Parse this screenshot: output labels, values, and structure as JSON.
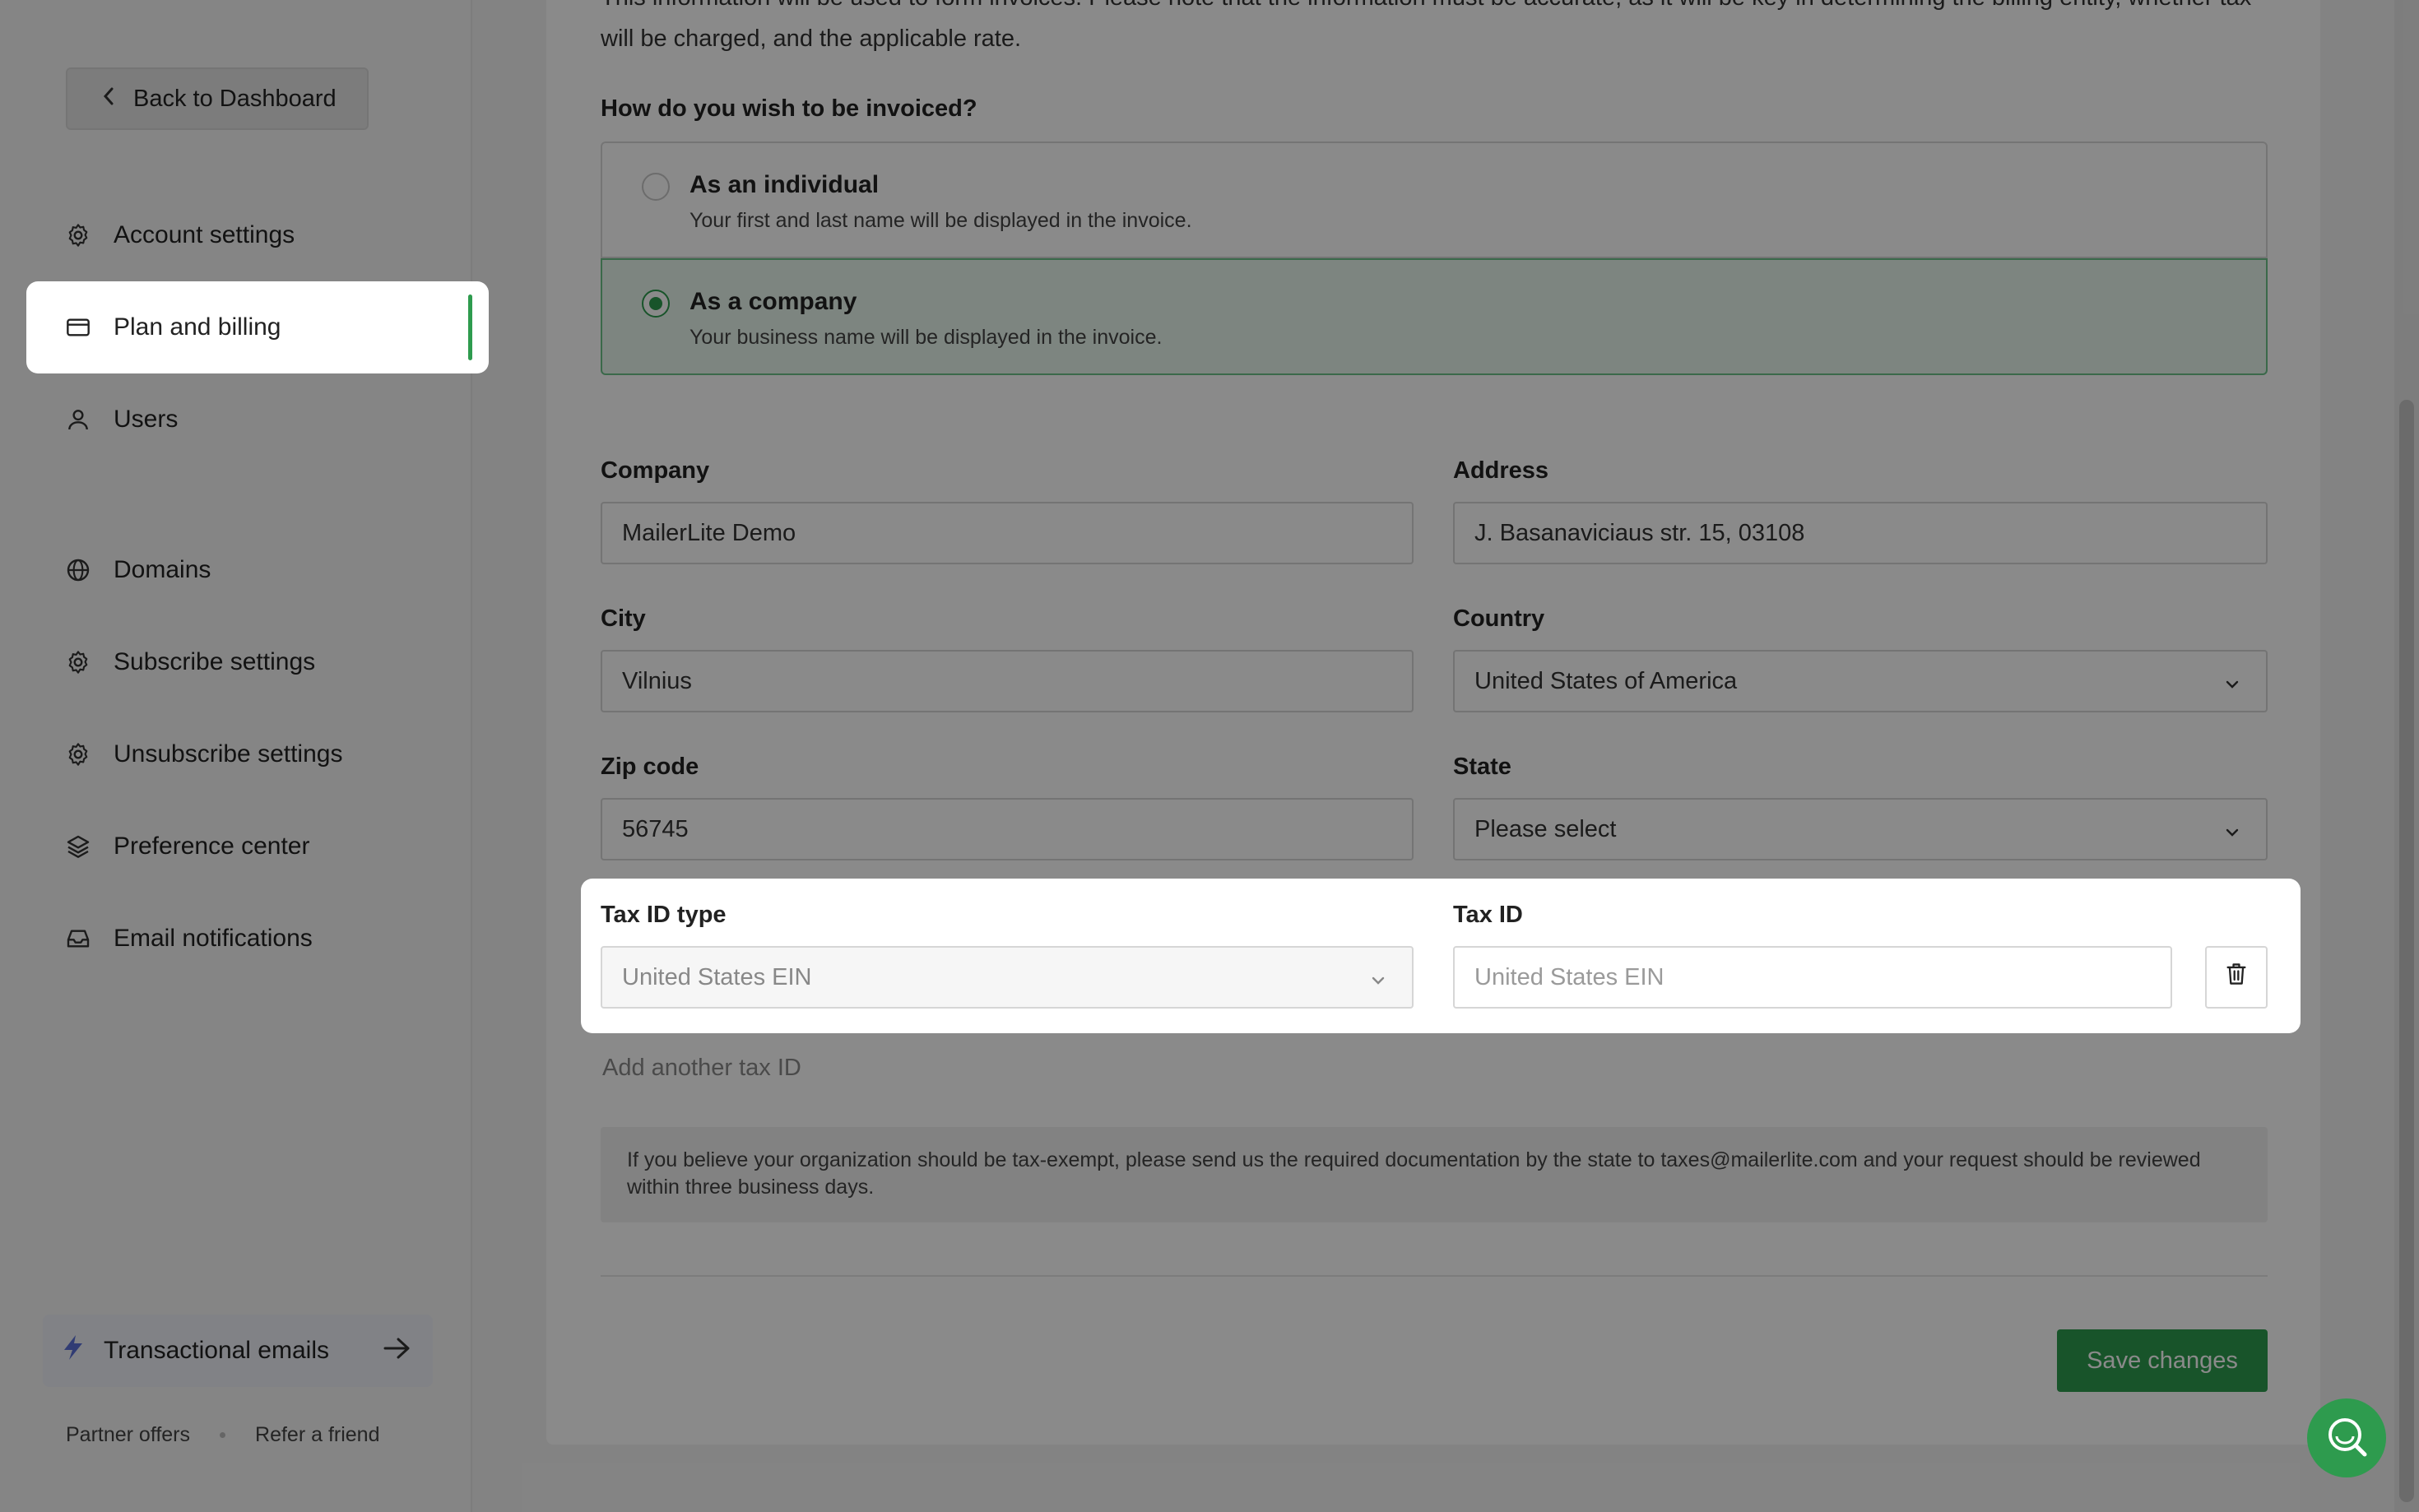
{
  "sidebar": {
    "back_label": "Back to Dashboard",
    "items": [
      {
        "label": "Account settings",
        "icon": "gear-icon"
      },
      {
        "label": "Plan and billing",
        "icon": "credit-card-icon",
        "active": true
      },
      {
        "label": "Users",
        "icon": "user-icon"
      },
      {
        "label": "Domains",
        "icon": "globe-icon"
      },
      {
        "label": "Subscribe settings",
        "icon": "gear-icon"
      },
      {
        "label": "Unsubscribe settings",
        "icon": "gear-icon"
      },
      {
        "label": "Preference center",
        "icon": "layers-icon"
      },
      {
        "label": "Email notifications",
        "icon": "inbox-icon"
      }
    ],
    "transactional_label": "Transactional emails",
    "footer": {
      "partner": "Partner offers",
      "refer": "Refer a friend"
    }
  },
  "main": {
    "intro": "This information will be used to form invoices. Please note that the information must be accurate, as it will be key in determining the billing entity, whether tax will be charged, and the applicable rate.",
    "invoice_question": "How do you wish to be invoiced?",
    "options": [
      {
        "title": "As an individual",
        "subtitle": "Your first and last name will be displayed in the invoice.",
        "selected": false
      },
      {
        "title": "As a company",
        "subtitle": "Your business name will be displayed in the invoice.",
        "selected": true
      }
    ],
    "fields": {
      "company": {
        "label": "Company",
        "value": "MailerLite Demo"
      },
      "address": {
        "label": "Address",
        "value": "J. Basanaviciaus str. 15, 03108"
      },
      "city": {
        "label": "City",
        "value": "Vilnius"
      },
      "country": {
        "label": "Country",
        "value": "United States of America"
      },
      "zip": {
        "label": "Zip code",
        "value": "56745"
      },
      "state": {
        "label": "State",
        "value": "Please select"
      },
      "tax_id_type": {
        "label": "Tax ID type",
        "value": "United States EIN"
      },
      "tax_id": {
        "label": "Tax ID",
        "placeholder": "United States EIN"
      }
    },
    "add_tax": "Add another tax ID",
    "notice": "If you believe your organization should be tax-exempt, please send us the required documentation by the state to taxes@mailerlite.com and your request should be reviewed within three business days.",
    "save_label": "Save changes"
  },
  "colors": {
    "accent": "#2e9b4e",
    "overlay": "rgba(0,0,0,0.46)"
  }
}
